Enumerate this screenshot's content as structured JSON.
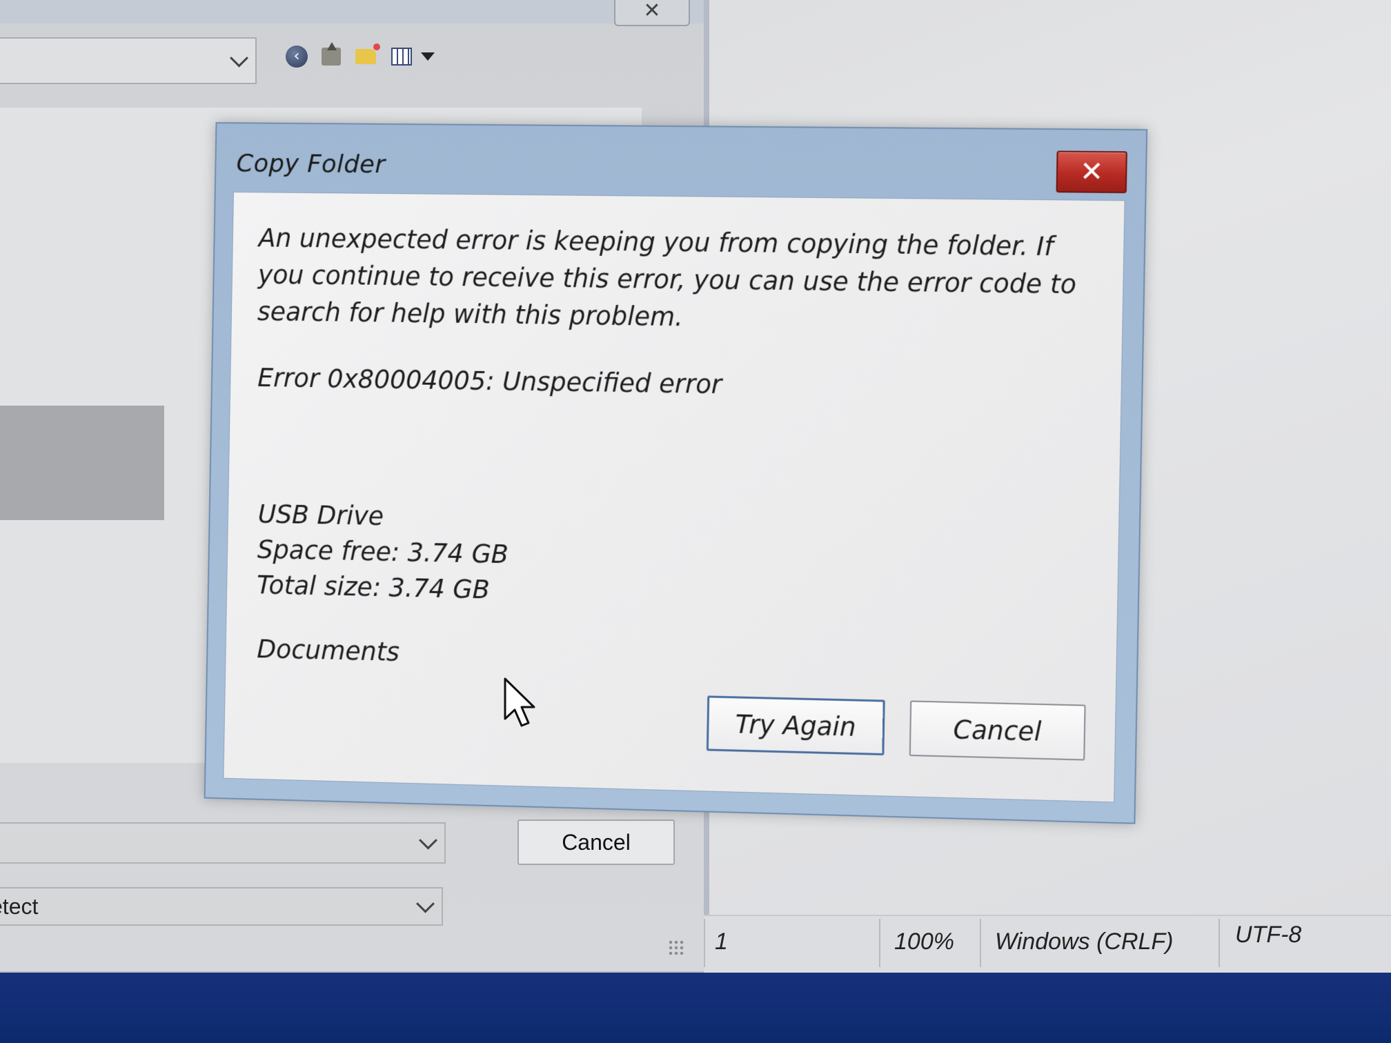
{
  "parent_window": {
    "encoding_value": "etect",
    "cancel_label": "Cancel"
  },
  "status_bar": {
    "line": "1",
    "zoom": "100%",
    "line_endings": "Windows (CRLF)",
    "encoding": "UTF-8"
  },
  "dialog": {
    "title": "Copy Folder",
    "close_symbol": "✕",
    "message": "An unexpected error is keeping you from copying the folder. If you continue to receive this error, you can use the error code to search for help with this problem.",
    "error": "Error 0x80004005: Unspecified error",
    "drive_name": "USB Drive",
    "space_free": "Space free: 3.74 GB",
    "total_size": "Total size: 3.74 GB",
    "folder_name": "Documents",
    "try_again_label": "Try Again",
    "cancel_label": "Cancel"
  },
  "colors": {
    "dialog_frame": "#a9c0da",
    "close_button": "#b72a22",
    "taskbar": "#0d2a6e"
  },
  "icons": [
    "back-icon",
    "up-folder-icon",
    "new-folder-icon",
    "view-menu-icon",
    "close-icon",
    "mouse-cursor-icon",
    "chevron-down-icon"
  ]
}
